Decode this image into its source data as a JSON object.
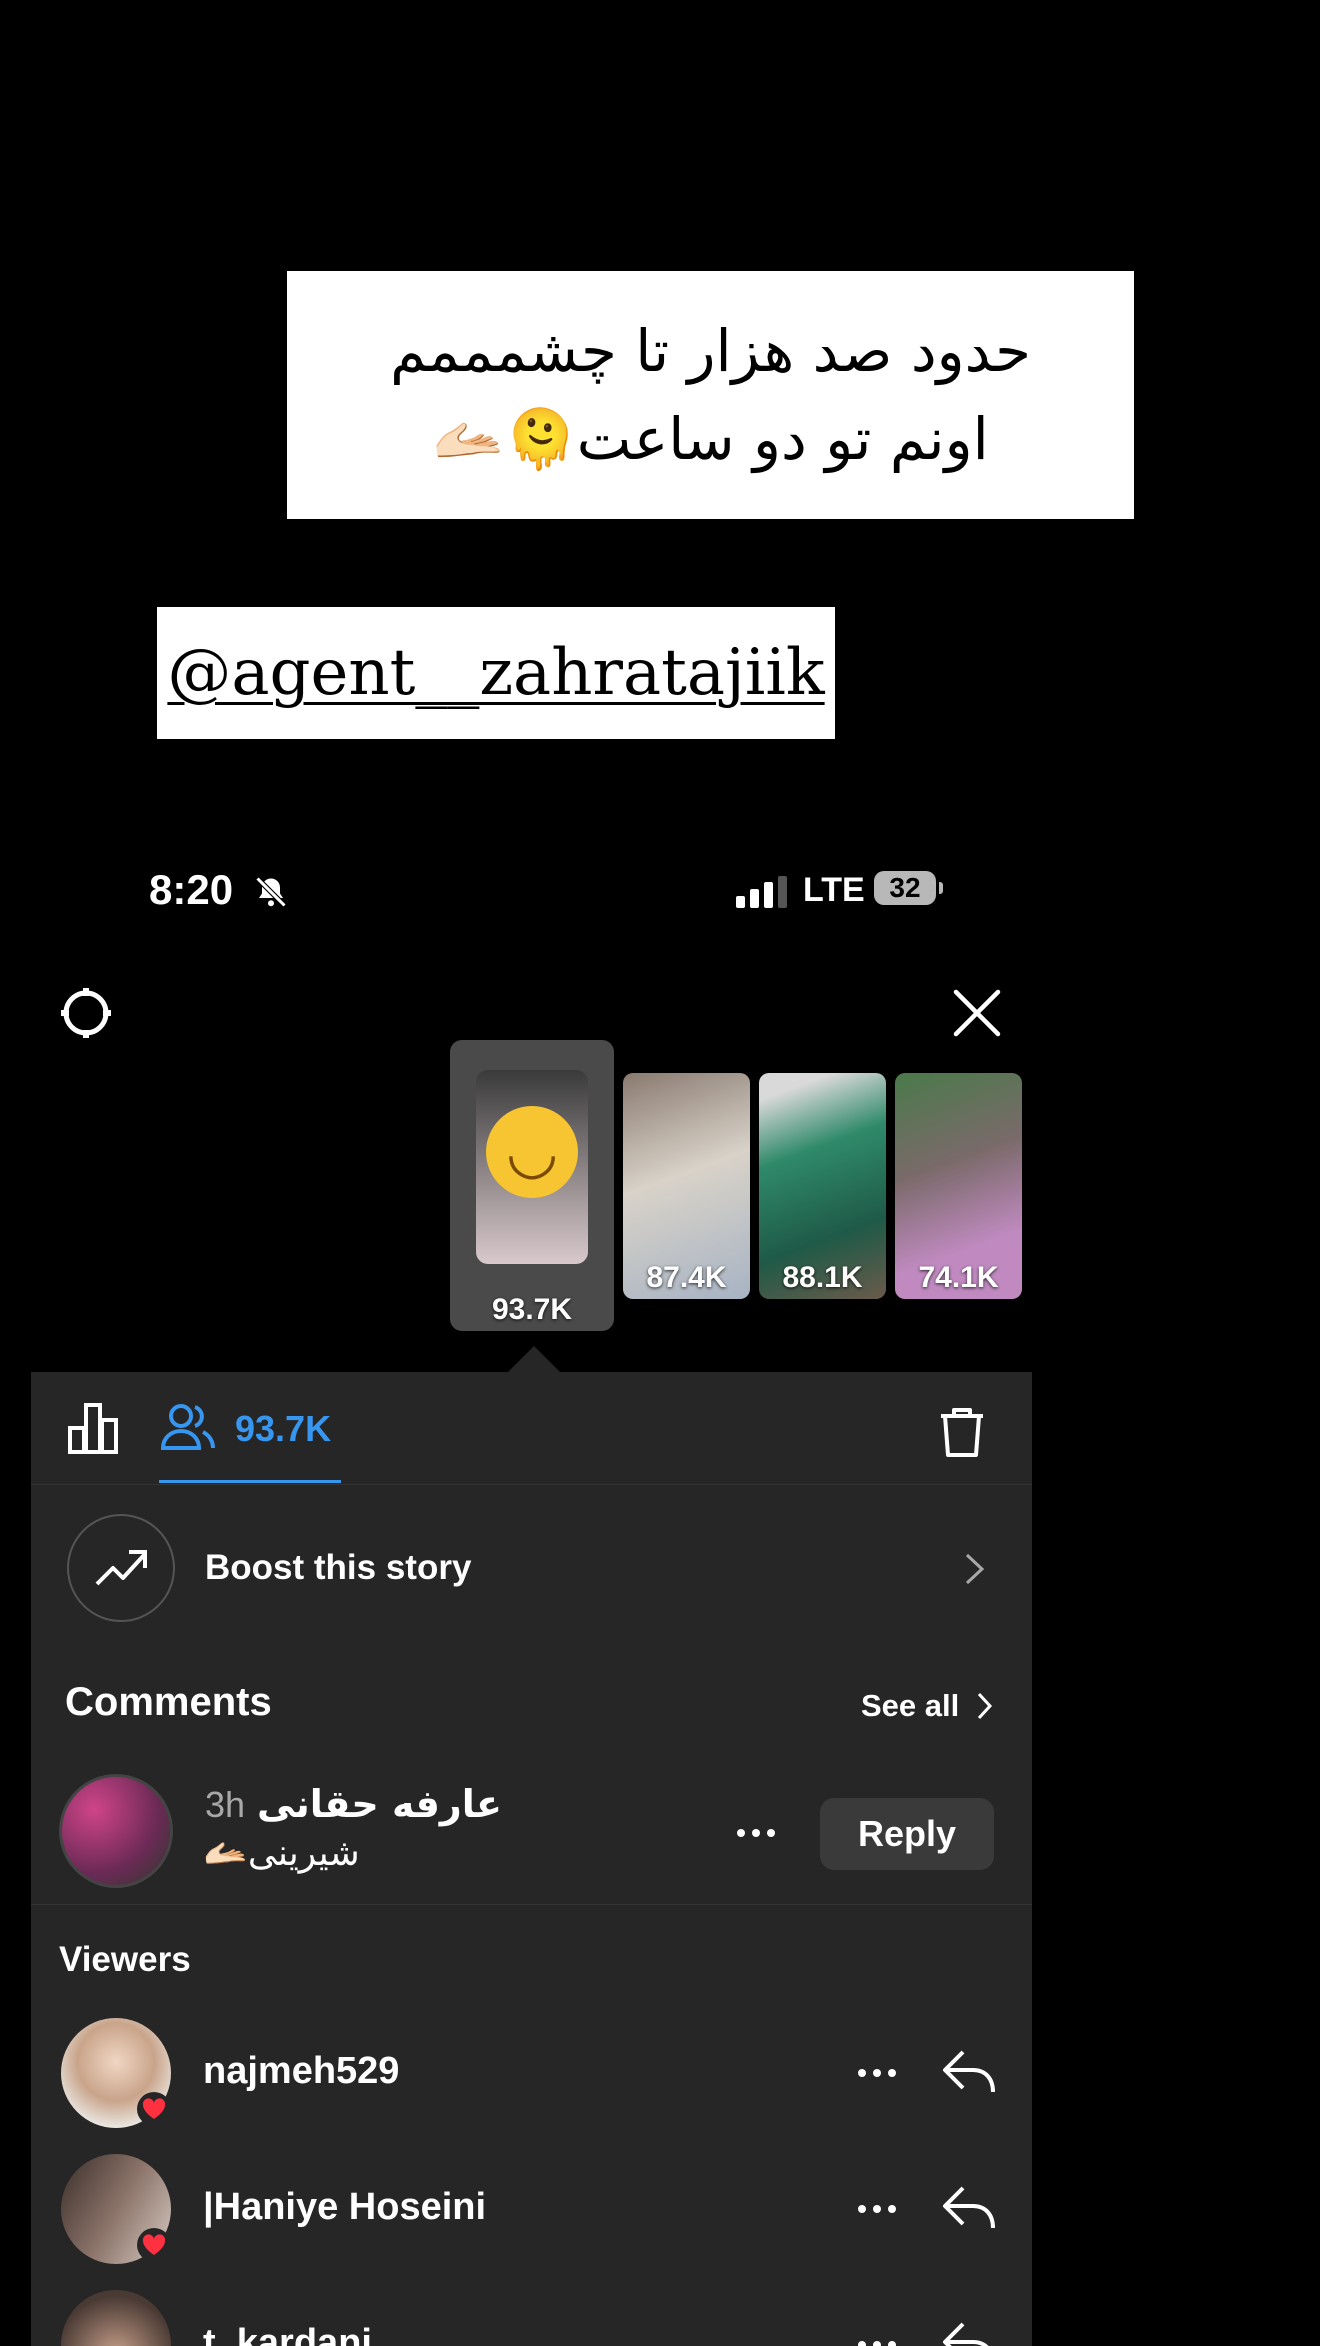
{
  "caption": {
    "line1": "حدود صد هزار تا چشمممم",
    "line2": "اونم تو دو ساعت🫠🫴🏻"
  },
  "mention": "@agent__zahratajiik",
  "status_bar": {
    "time": "8:20",
    "network": "LTE",
    "battery": "32"
  },
  "stories": [
    {
      "views": "93.7K",
      "active": true
    },
    {
      "views": "87.4K"
    },
    {
      "views": "88.1K"
    },
    {
      "views": "74.1K"
    }
  ],
  "tabs": {
    "viewers_count": "93.7K"
  },
  "boost": {
    "label": "Boost this story"
  },
  "comments": {
    "title": "Comments",
    "see_all": "See all",
    "items": [
      {
        "time": "3h",
        "name": "عارفه حقانی",
        "text": "شیرینی🫴🏻",
        "reply": "Reply"
      }
    ]
  },
  "viewers": {
    "title": "Viewers",
    "items": [
      {
        "name": "najmeh529",
        "liked": true
      },
      {
        "name": "|Haniye Hoseini",
        "liked": true
      },
      {
        "name": "t_kardani",
        "liked": false
      }
    ]
  },
  "colors": {
    "accent": "#3797f0",
    "panel": "#262626",
    "heart": "#ff3040"
  }
}
